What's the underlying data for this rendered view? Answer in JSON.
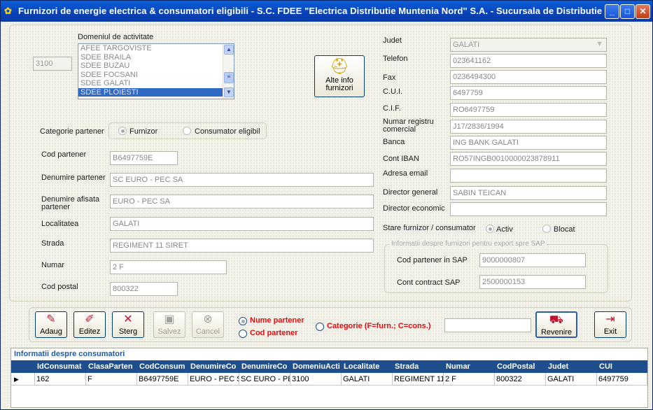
{
  "window": {
    "title": "Furnizori de energie electrica & consumatori eligibili - S.C. FDEE \"Electrica Distributie Muntenia Nord\" S.A. - Sucursala de Distributie a ...",
    "minimize": "_",
    "maximize": "□",
    "close": "✕"
  },
  "form": {
    "id_value": "3100",
    "domeniu_label": "Domeniul de activitate",
    "domeniu_items": [
      "AFEE TARGOVISTE",
      "SDEE BRAILA",
      "SDEE BUZAU",
      "SDEE FOCSANI",
      "SDEE GALATI",
      "SDEE PLOIESTI"
    ],
    "domeniu_selected": "SDEE PLOIESTI",
    "alte_info_label": "Alte info furnizori",
    "categorie_label": "Categorie partener",
    "categorie_furnizor": "Furnizor",
    "categorie_consumator": "Consumator eligibil",
    "cod_partener_label": "Cod partener",
    "cod_partener_value": "B6497759E",
    "denumire_label": "Denumire partener",
    "denumire_value": "SC EURO - PEC SA",
    "denumire_afisata_label": "Denumire afisata partener",
    "denumire_afisata_value": "EURO - PEC SA",
    "localitatea_label": "Localitatea",
    "localitatea_value": "GALATI",
    "strada_label": "Strada",
    "strada_value": "REGIMENT 11 SIRET",
    "numar_label": "Numar",
    "numar_value": "2 F",
    "cod_postal_label": "Cod postal",
    "cod_postal_value": "800322",
    "judet_label": "Judet",
    "judet_value": "GALATI",
    "telefon_label": "Telefon",
    "telefon_value": "023641162",
    "fax_label": "Fax",
    "fax_value": "0236494300",
    "cui_label": "C.U.I.",
    "cui_value": "6497759",
    "cif_label": "C.I.F.",
    "cif_value": "RO6497759",
    "nr_registru_label": "Numar registru comercial",
    "nr_registru_value": "J17/2836/1994",
    "banca_label": "Banca",
    "banca_value": "ING BANK GALATI",
    "iban_label": "Cont IBAN",
    "iban_value": "RO57INGB0010000023878911",
    "email_label": "Adresa email",
    "email_value": "",
    "director_general_label": "Director general",
    "director_general_value": "SABIN TEICAN",
    "director_economic_label": "Director economic",
    "director_economic_value": "",
    "stare_label": "Stare furnizor / consumator",
    "stare_activ": "Activ",
    "stare_blocat": "Blocat",
    "sap_group_label": "Informatii despre furnizori pentru export spre SAP",
    "sap_cod_label": "Cod partener in SAP",
    "sap_cod_value": "9000000807",
    "sap_contract_label": "Cont contract SAP",
    "sap_contract_value": "2500000153"
  },
  "toolbar": {
    "adaug": "Adaug",
    "editez": "Editez",
    "sterg": "Sterg",
    "salvez": "Salvez",
    "cancel": "Cancel",
    "nume_partener": "Nume partener",
    "cod_partener": "Cod partener",
    "categorie": "Categorie (F=furn.; C=cons.)",
    "search_value": "",
    "revenire": "Revenire",
    "exit": "Exit"
  },
  "grid": {
    "title": "Informatii despre consumatori",
    "columns": [
      "IdConsumat",
      "ClasaParten",
      "CodConsum",
      "DenumireCo",
      "DenumireCo",
      "DomeniuActi",
      "Localitate",
      "Strada",
      "Numar",
      "CodPostal",
      "Judet",
      "CUI"
    ],
    "rows": [
      [
        "162",
        "F",
        "B6497759E",
        "EURO - PEC S",
        "SC EURO - PE",
        "3100",
        "GALATI",
        "REGIMENT 11",
        "2 F",
        "800322",
        "GALATI",
        "6497759"
      ]
    ]
  },
  "colors": {
    "titlebar": "#0842b8",
    "grid_header": "#1f4e8c",
    "accent_red": "#e01010"
  }
}
